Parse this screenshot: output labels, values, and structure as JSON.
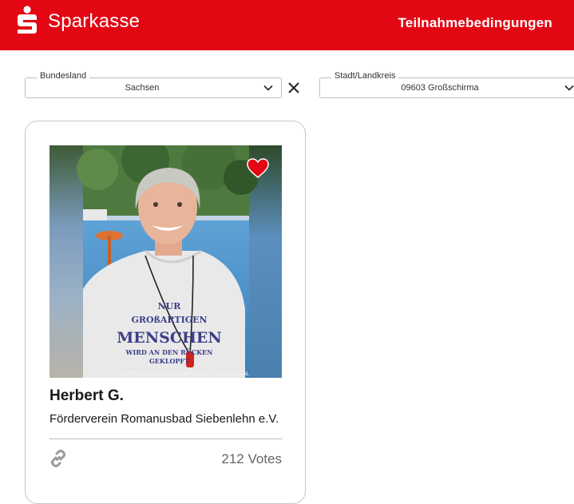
{
  "header": {
    "brand": "Sparkasse",
    "terms_link": "Teilnahmebedingungen",
    "brand_color": "#e30613"
  },
  "filters": {
    "state": {
      "label": "Bundesland",
      "value": "Sachsen"
    },
    "city": {
      "label": "Stadt/Landkreis",
      "value": "09603 Großschirma"
    }
  },
  "card": {
    "name": "Herbert G.",
    "organization": "Förderverein Romanusbad Siebenlehn e.V.",
    "votes": "212 Votes",
    "photo": {
      "shirt_text": [
        "NUR",
        "GROßARTIGEN",
        "MENSCHEN",
        "WIRD AN DEN RÜCKEN",
        "GEKLOPFT"
      ],
      "copyright": "COPYRIGHT: GORDON WELTERS STARTSOCIAL"
    }
  },
  "icons": {
    "logo": "sparkasse-s-icon",
    "chevron": "chevron-down-icon",
    "clear": "close-icon",
    "favorite": "heart-icon",
    "share": "link-icon"
  }
}
